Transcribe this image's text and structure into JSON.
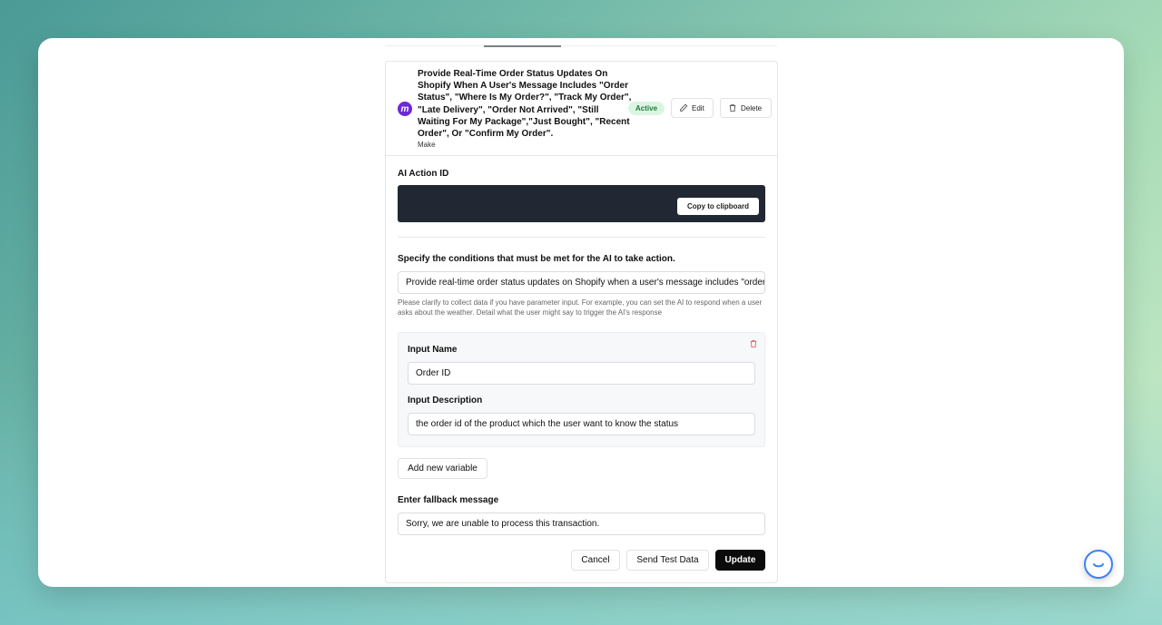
{
  "action": {
    "title": "Provide Real-Time Order Status Updates On Shopify When A User's Message Includes \"Order Status\", \"Where Is My Order?\", \"Track My Order\", \"Late Delivery\", \"Order Not Arrived\", \"Still Waiting For My Package\",\"Just Bought\", \"Recent Order\", Or \"Confirm My Order\".",
    "app_name": "Make",
    "status": "Active",
    "edit_label": "Edit",
    "delete_label": "Delete"
  },
  "ai_action_id": {
    "label": "AI Action ID",
    "copy_label": "Copy to clipboard"
  },
  "conditions": {
    "label": "Specify the conditions that must be met for the AI to take action.",
    "value": "Provide real-time order status updates on Shopify when a user's message includes \"order status\", \"where is my order?\", \"track my order\"",
    "help": "Please clarify to collect data if you have parameter input. For example, you can set the AI to respond when a user asks about the weather. Detail what the user might say to trigger the AI's response"
  },
  "variable": {
    "name_label": "Input Name",
    "name_value": "Order ID",
    "desc_label": "Input Description",
    "desc_value": "the order id of the product which the user want to know the status"
  },
  "add_variable_label": "Add new variable",
  "fallback": {
    "label": "Enter fallback message",
    "value": "Sorry, we are unable to process this transaction."
  },
  "footer": {
    "cancel_label": "Cancel",
    "test_label": "Send Test Data",
    "update_label": "Update"
  },
  "colors": {
    "brand": "#6d28d9",
    "badge_bg": "#dcf5e3",
    "dark_box": "#212833"
  }
}
